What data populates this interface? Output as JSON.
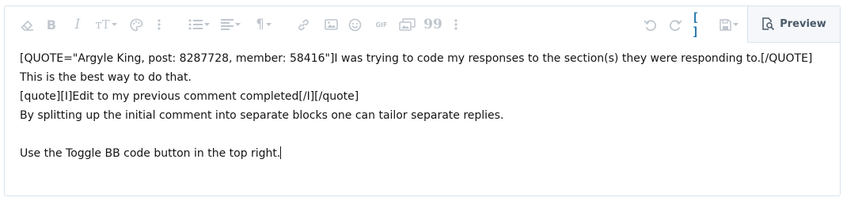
{
  "toolbar": {
    "buttons": [
      {
        "name": "remove-formatting",
        "icon": "eraser-icon"
      },
      {
        "name": "bold",
        "icon": "bold-icon",
        "glyph": "B"
      },
      {
        "name": "italic",
        "icon": "italic-icon",
        "glyph": "I"
      },
      {
        "name": "text-size",
        "icon": "text-size-icon",
        "glyph": "тT"
      },
      {
        "name": "text-color",
        "icon": "palette-icon"
      },
      {
        "name": "more-text",
        "icon": "more-vertical-icon"
      },
      {
        "name": "list",
        "icon": "list-icon"
      },
      {
        "name": "align",
        "icon": "align-left-icon"
      },
      {
        "name": "paragraph",
        "icon": "paragraph-icon",
        "glyph": "¶"
      },
      {
        "name": "link",
        "icon": "link-icon"
      },
      {
        "name": "image",
        "icon": "image-icon"
      },
      {
        "name": "smilies",
        "icon": "smile-icon"
      },
      {
        "name": "gif",
        "icon": "gif-icon",
        "glyph": "GIF"
      },
      {
        "name": "media",
        "icon": "media-icon"
      },
      {
        "name": "quote",
        "icon": "quote-icon",
        "glyph": "99"
      },
      {
        "name": "more-insert",
        "icon": "more-vertical-icon"
      },
      {
        "name": "undo",
        "icon": "undo-icon"
      },
      {
        "name": "redo",
        "icon": "redo-icon"
      },
      {
        "name": "toggle-bbcode",
        "icon": "brackets-icon",
        "glyph": "[ ]"
      },
      {
        "name": "drafts",
        "icon": "save-icon"
      }
    ],
    "preview_label": "Preview",
    "colors": {
      "icon": "#bfc6ce",
      "active_icon": "#2577b1",
      "border": "#d8e2ec"
    }
  },
  "content": {
    "lines": [
      "[QUOTE=\"Argyle King, post: 8287728, member: 58416\"]I was trying to code my responses to the section(s) they were responding to.[/QUOTE]",
      "This is the best way to do that.",
      "[quote][I]Edit to my previous comment completed[/I][/quote]",
      "By splitting up the initial comment into separate blocks one can tailor separate replies.",
      "",
      "Use the Toggle BB code button in the top right."
    ]
  }
}
